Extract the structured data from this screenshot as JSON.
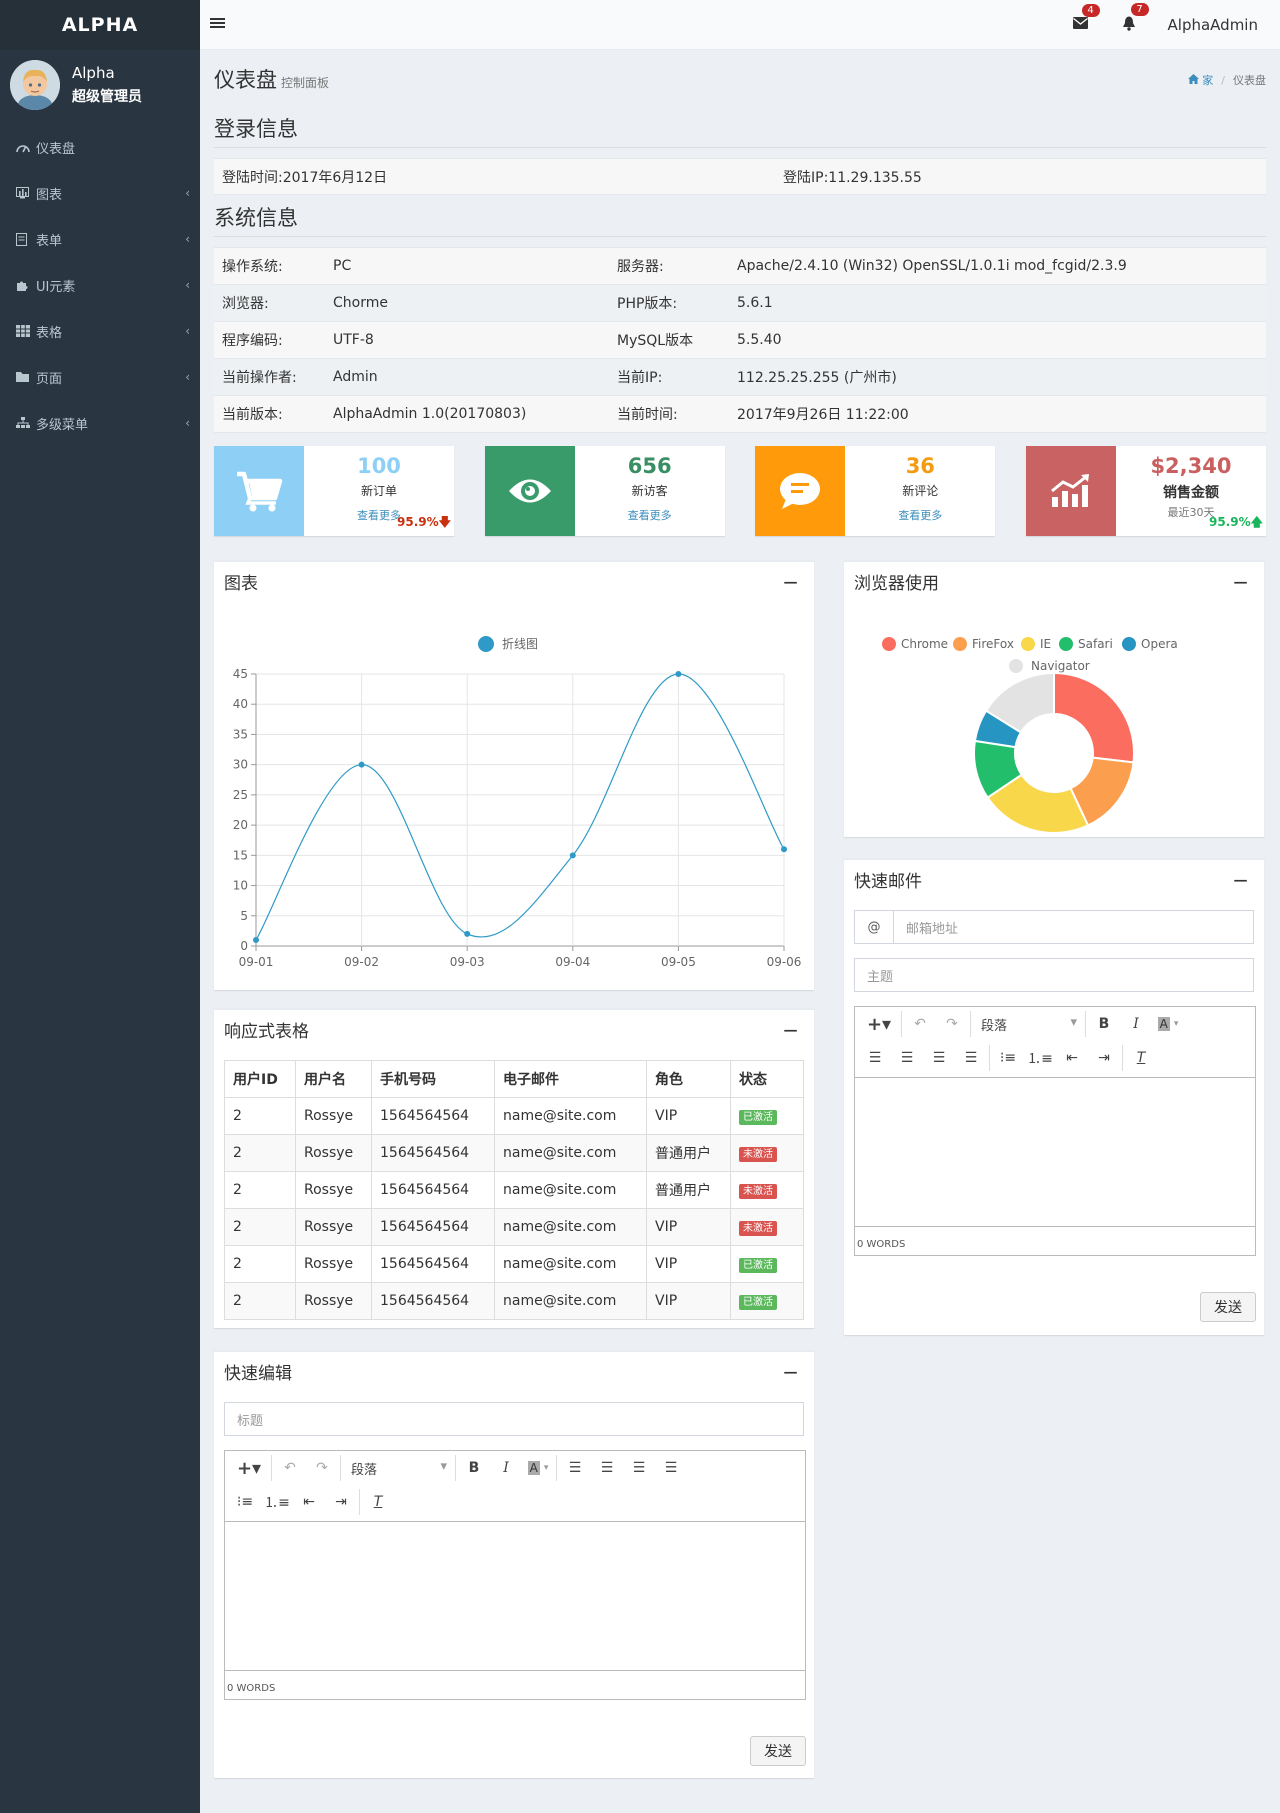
{
  "sidebar": {
    "brand": "ALPHA",
    "user_name": "Alpha",
    "user_role": "超级管理员",
    "items": [
      {
        "label": "仪表盘",
        "icon": "dashboard-icon"
      },
      {
        "label": "图表",
        "icon": "bar-chart-icon"
      },
      {
        "label": "表单",
        "icon": "form-icon"
      },
      {
        "label": "UI元素",
        "icon": "puzzle-icon"
      },
      {
        "label": "表格",
        "icon": "table-icon"
      },
      {
        "label": "页面",
        "icon": "folder-icon"
      },
      {
        "label": "多级菜单",
        "icon": "sitemap-icon"
      }
    ]
  },
  "topbar": {
    "mail_count": "4",
    "bell_count": "7",
    "user": "AlphaAdmin"
  },
  "header": {
    "title": "仪表盘",
    "subtitle": "控制面板",
    "breadcrumb_home": "家",
    "breadcrumb_current": "仪表盘"
  },
  "login": {
    "title": "登录信息",
    "time": "登陆时间:2017年6月12日",
    "ip": "登陆IP:11.29.135.55"
  },
  "system": {
    "title": "系统信息",
    "rows": [
      {
        "k1": "操作系统:",
        "v1": "PC",
        "k2": "服务器:",
        "v2": "Apache/2.4.10 (Win32) OpenSSL/1.0.1i mod_fcgid/2.3.9"
      },
      {
        "k1": "浏览器:",
        "v1": "Chorme",
        "k2": "PHP版本:",
        "v2": "5.6.1"
      },
      {
        "k1": "程序编码:",
        "v1": "UTF-8",
        "k2": "MySQL版本",
        "v2": "5.5.40"
      },
      {
        "k1": "当前操作者:",
        "v1": "Admin",
        "k2": "当前IP:",
        "v2": "112.25.25.255 (广州市)"
      },
      {
        "k1": "当前版本:",
        "v1": "AlphaAdmin 1.0(20170803)",
        "k2": "当前时间:",
        "v2": "2017年9月26日 11:22:00"
      }
    ]
  },
  "stats": [
    {
      "value": "100",
      "label": "新订单",
      "more": "查看更多",
      "pct": "95.9%",
      "color": "#8ecff5",
      "value_color": "#8ecff5",
      "icon": "cart-icon"
    },
    {
      "value": "656",
      "label": "新访客",
      "more": "查看更多",
      "color": "#3a9b6a",
      "value_color": "#3a8e63",
      "icon": "eye-icon"
    },
    {
      "value": "36",
      "label": "新评论",
      "more": "查看更多",
      "color": "#ff9a0a",
      "value_color": "#f39c12",
      "icon": "comment-icon"
    },
    {
      "value": "$2,340",
      "label": "销售金额",
      "more": "最近30天",
      "pct": "95.9%",
      "color": "#c96262",
      "value_color": "#c9605f",
      "icon": "trend-chart-icon"
    }
  ],
  "line_box": {
    "title": "图表",
    "collapse": "−"
  },
  "browser_box": {
    "title": "浏览器使用",
    "collapse": "−"
  },
  "table_box": {
    "title": "响应式表格",
    "collapse": "−",
    "headers": [
      "用户ID",
      "用户名",
      "手机号码",
      "电子邮件",
      "角色",
      "状态"
    ],
    "rows": [
      {
        "id": "2",
        "name": "Rossye",
        "phone": "1564564564",
        "email": "name@site.com",
        "role": "VIP",
        "status": "已激活"
      },
      {
        "id": "2",
        "name": "Rossye",
        "phone": "1564564564",
        "email": "name@site.com",
        "role": "普通用户",
        "status": "未激活"
      },
      {
        "id": "2",
        "name": "Rossye",
        "phone": "1564564564",
        "email": "name@site.com",
        "role": "普通用户",
        "status": "未激活"
      },
      {
        "id": "2",
        "name": "Rossye",
        "phone": "1564564564",
        "email": "name@site.com",
        "role": "VIP",
        "status": "未激活"
      },
      {
        "id": "2",
        "name": "Rossye",
        "phone": "1564564564",
        "email": "name@site.com",
        "role": "VIP",
        "status": "已激活"
      },
      {
        "id": "2",
        "name": "Rossye",
        "phone": "1564564564",
        "email": "name@site.com",
        "role": "VIP",
        "status": "已激活"
      }
    ],
    "active_color": "#5cb85c",
    "inactive_color": "#d9534f"
  },
  "mail_box": {
    "title": "快速邮件",
    "collapse": "−",
    "at": "@",
    "email_placeholder": "邮箱地址",
    "subject_placeholder": "主题",
    "paragraph": "段落",
    "words": "0 WORDS",
    "send": "发送"
  },
  "edit_box": {
    "title": "快速编辑",
    "collapse": "−",
    "title_placeholder": "标题",
    "paragraph": "段落",
    "words": "0 WORDS",
    "send": "发送"
  },
  "chart_data": [
    {
      "type": "line",
      "legend": [
        "折线图"
      ],
      "x": [
        "09-01",
        "09-02",
        "09-03",
        "09-04",
        "09-05",
        "09-06"
      ],
      "series": [
        {
          "name": "折线图",
          "values": [
            1,
            30,
            2,
            15,
            45,
            16
          ],
          "color": "#2f9ac7"
        }
      ],
      "ylim": [
        0,
        45
      ],
      "yticks": [
        0,
        5,
        10,
        15,
        20,
        25,
        30,
        35,
        40,
        45
      ],
      "grid": true
    },
    {
      "type": "pie",
      "donut": true,
      "labels": [
        "Chrome",
        "FireFox",
        "IE",
        "Safari",
        "Opera",
        "Navigator"
      ],
      "values": [
        25,
        15,
        21,
        11,
        6,
        15
      ],
      "colors": [
        "#fb6d5e",
        "#fb9f4f",
        "#f8d84a",
        "#22be6c",
        "#2695c2",
        "#e3e3e3"
      ],
      "legend": "top"
    }
  ]
}
